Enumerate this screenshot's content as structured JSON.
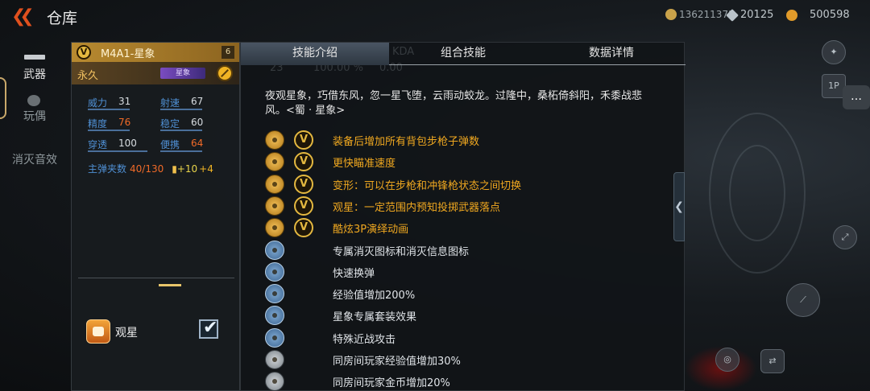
{
  "header": {
    "back_icon": "double-chevron-left-icon",
    "title": "仓库",
    "currencies": [
      {
        "icon": "coin-icon",
        "value": "136211372",
        "color": "#c9a24a"
      },
      {
        "icon": "diamond-icon",
        "value": "20125",
        "color": "#b9c2c9"
      },
      {
        "icon": "gold-icon",
        "value": "500598",
        "color": "#e09a2a"
      }
    ]
  },
  "leftnav": {
    "items": [
      {
        "label": "武器",
        "active": true
      },
      {
        "label": "玩偶",
        "active": false
      },
      {
        "label": "消灭音效",
        "active": false
      }
    ]
  },
  "weapon": {
    "badge": "V",
    "name": "M4A1-星象",
    "level": "6",
    "duration": "永久",
    "brand_tag": "星象",
    "stats": [
      {
        "label": "威力",
        "value": "31",
        "highlight": false
      },
      {
        "label": "射速",
        "value": "67",
        "highlight": false
      },
      {
        "label": "精度",
        "value": "76",
        "highlight": true
      },
      {
        "label": "稳定",
        "value": "60",
        "highlight": false
      },
      {
        "label": "穿透",
        "value": "100",
        "highlight": false
      },
      {
        "label": "便携",
        "value": "64",
        "highlight": true
      }
    ],
    "ammo_label": "主弹夹数",
    "ammo_count": "40/130",
    "ammo_bonus1": "+10",
    "ammo_bonus2": "+4",
    "skill_toggle_label": "观星",
    "skill_toggle_checked": true
  },
  "tabs": [
    {
      "label": "技能介绍",
      "active": true
    },
    {
      "label": "组合技能",
      "active": false
    },
    {
      "label": "数据详情",
      "active": false
    }
  ],
  "ghost_text": {
    "kda_label": "KDA",
    "val1": "23",
    "val2": "100.00 %",
    "val3": "0.00"
  },
  "description": "夜观星象，巧借东风，忽一星飞堕，云雨动蛟龙。过隆中，桑柘倚斜阳，禾黍战悲风。<蜀 · 星象>",
  "features": [
    {
      "icon": "rifle-ammo-icon",
      "icon_style": "gold",
      "v_badge": true,
      "text": "装备后增加所有背包步枪子弹数",
      "color": "gold"
    },
    {
      "icon": "crosshair-icon",
      "icon_style": "gold",
      "v_badge": true,
      "text": "更快瞄准速度",
      "color": "gold"
    },
    {
      "icon": "transform-icon",
      "icon_style": "gold",
      "v_badge": true,
      "text": "变形：可以在步枪和冲锋枪状态之间切换",
      "color": "gold"
    },
    {
      "icon": "grenade-predict-icon",
      "icon_style": "gold",
      "v_badge": true,
      "text": "观星：一定范围内预知投掷武器落点",
      "color": "gold"
    },
    {
      "icon": "animation-icon",
      "icon_style": "gold",
      "v_badge": true,
      "text": "酷炫3P演绎动画",
      "color": "gold"
    },
    {
      "icon": "kill-icon",
      "icon_style": "blue",
      "v_badge": false,
      "text": "专属消灭图标和消灭信息图标",
      "color": "white"
    },
    {
      "icon": "reload-icon",
      "icon_style": "blue",
      "v_badge": false,
      "text": "快速换弹",
      "color": "white"
    },
    {
      "icon": "exp-icon",
      "icon_style": "blue",
      "v_badge": false,
      "text": "经验值增加200%",
      "color": "white"
    },
    {
      "icon": "suit-icon",
      "icon_style": "blue",
      "v_badge": false,
      "text": "星象专属套装效果",
      "color": "white"
    },
    {
      "icon": "melee-icon",
      "icon_style": "blue",
      "v_badge": false,
      "text": "特殊近战攻击",
      "color": "white"
    },
    {
      "icon": "room-exp-icon",
      "icon_style": "grey",
      "v_badge": false,
      "text": "同房间玩家经验值增加30%",
      "color": "white"
    },
    {
      "icon": "room-gold-icon",
      "icon_style": "grey",
      "v_badge": false,
      "text": "同房间玩家金币增加20%",
      "color": "white"
    }
  ],
  "right": {
    "collapse_icon": "chevron-left-icon",
    "chat_icon": "chat-icon",
    "view_label": "1P"
  }
}
